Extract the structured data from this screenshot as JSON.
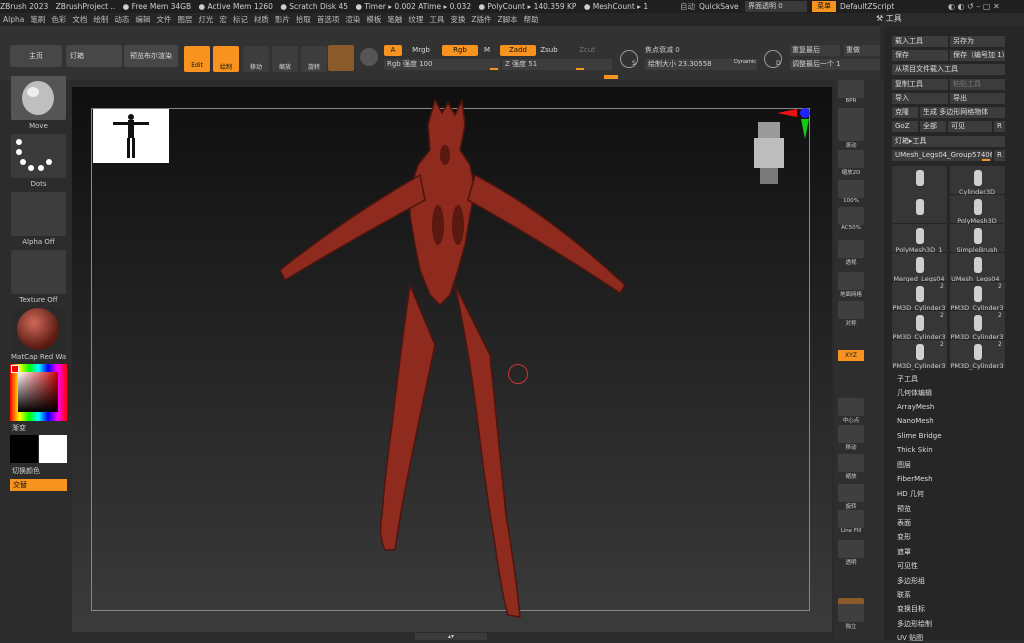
{
  "titlebar": {
    "items": [
      "ZBrush 2023",
      "ZBrushProject  ..",
      "● Free Mem 34GB",
      "● Active Mem 1260",
      "● Scratch Disk 45",
      "● Timer ▸ 0.002 ATime ▸ 0.032",
      "● PolyCount ▸ 140.359 KP",
      "● MeshCount ▸ 1"
    ],
    "auto": "自动",
    "quicksave": "QuickSave",
    "ui_transparency": "界面透明 0",
    "menu_label": "菜单",
    "default_zscript": "DefaultZScript"
  },
  "menubar": [
    "Alpha",
    "笔刷",
    "色彩",
    "文档",
    "绘制",
    "动态",
    "编辑",
    "文件",
    "图层",
    "灯光",
    "宏",
    "标记",
    "材质",
    "影片",
    "拾取",
    "首选项",
    "渲染",
    "模板",
    "笔触",
    "纹理",
    "工具",
    "变换",
    "Z插件",
    "Z脚本",
    "帮助"
  ],
  "topbar": {
    "home": "主页",
    "lightbox": "灯箱",
    "preview_render": "预览布尔渲染",
    "edit": "Edit",
    "draw": "绘制",
    "move": "移动",
    "scale": "缩放",
    "rotate": "旋转",
    "a_label": "A",
    "mrgb": "Mrgb",
    "rgb": "Rgb",
    "m": "M",
    "zadd": "Zadd",
    "zsub": "Zsub",
    "zcut": "Zcut",
    "rgb_intensity": "Rgb 强度 100",
    "z_intensity": "Z 强度 51",
    "focal_shift": "焦点衰减 0",
    "draw_size": "绘制大小 23.30558",
    "dynamic": "Dynamic",
    "s_label": "S",
    "d_label": "D",
    "redo_last": "重复最后",
    "redo_last_short": "重做",
    "adjust_last": "调整最后一个 1"
  },
  "leftshelf": {
    "brush": "Move",
    "stroke": "Dots",
    "alpha": "Alpha Off",
    "texture": "Texture Off",
    "material": "MatCap Red Wa",
    "gradient": "渐变",
    "switch_color": "切换颜色",
    "alternate": "交替"
  },
  "rightshelf": [
    "BPR",
    "子像素",
    "滚动",
    "缩放2D",
    "100%",
    "AC50%",
    "Dynamic",
    "透视",
    "地面网格",
    "对称",
    "XYZ",
    "",
    "",
    "中心点",
    "移动",
    "缩放",
    "旋转",
    "Line Fill",
    "透明",
    "Dynamic",
    "独立"
  ],
  "toolpanel": {
    "title": "工具",
    "load_tool": "载入工具",
    "save_as": "另存为",
    "save": "保存",
    "save_with_num": "保存（编号加 1）",
    "load_from_project": "从项目文件载入工具",
    "copy_tool": "复制工具",
    "paste_tool": "粘贴工具",
    "import": "导入",
    "export": "导出",
    "clone": "克隆",
    "make_polymesh": "生成 多边形网格物体",
    "goz": "GoZ",
    "all": "全部",
    "visible": "可见",
    "r": "R",
    "lightbox_tools": "灯箱▸工具",
    "current_tool": "UMesh_Legs04_Group57406",
    "subtools": [
      {
        "label": "UMesh_Legs04_",
        "num": ""
      },
      {
        "label": "Cylinder3D",
        "num": ""
      },
      {
        "label": "",
        "num": ""
      },
      {
        "label": "PolyMesh3D",
        "num": ""
      },
      {
        "label": "PolyMesh3D_1",
        "num": ""
      },
      {
        "label": "SimpleBrush",
        "num": ""
      },
      {
        "label": "Merged_Legs04",
        "num": ""
      },
      {
        "label": "UMesh_Legs04_",
        "num": ""
      },
      {
        "label": "PM3D_Cylinder3",
        "num": "2"
      },
      {
        "label": "PM3D_Cylinder3",
        "num": "2"
      },
      {
        "label": "PM3D_Cylinder3",
        "num": "2"
      },
      {
        "label": "PM3D_Cylinder3",
        "num": "2"
      },
      {
        "label": "PM3D_Cylinder3",
        "num": "2"
      },
      {
        "label": "PM3D_Cylinder3",
        "num": "2"
      }
    ],
    "sections": [
      "子工具",
      "几何体编辑",
      "ArrayMesh",
      "NanoMesh",
      "Slime Bridge",
      "Thick Skin",
      "图层",
      "FiberMesh",
      "HD 几何",
      "预览",
      "表面",
      "变形",
      "遮罩",
      "可见性",
      "多边形组",
      "联系",
      "变换目标",
      "多边形绘制",
      "UV 贴图"
    ]
  },
  "colors": {
    "accent": "#f7931e",
    "sculpt": "#8e2a1e"
  }
}
